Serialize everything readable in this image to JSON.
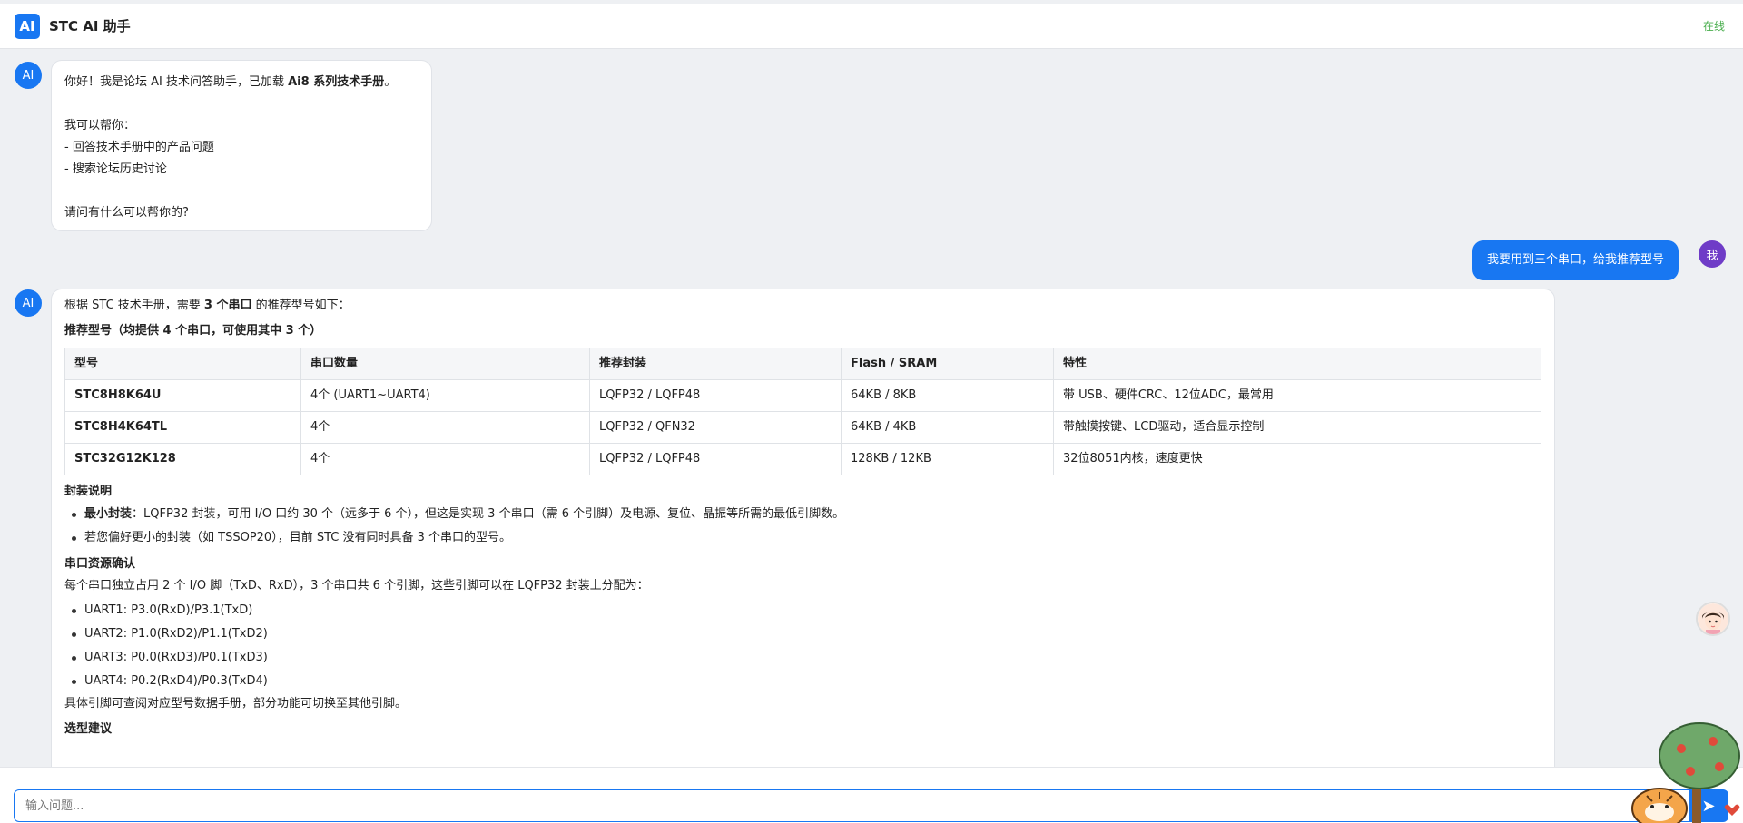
{
  "header": {
    "logo": "AI",
    "title": "STC AI 助手",
    "status": "在线"
  },
  "messages": {
    "ai_avatar": "AI",
    "me_avatar": "我",
    "greeting": {
      "line1_pre": "你好！我是论坛 AI 技术问答助手，已加载 ",
      "line1_bold": "Ai8 系列技术手册",
      "line1_post": "。",
      "line2": "我可以帮你：",
      "line3": "- 回答技术手册中的产品问题",
      "line4": "- 搜索论坛历史讨论",
      "line5": "请问有什么可以帮你的?"
    },
    "user_question": "我要用到三个串口，给我推荐型号",
    "answer": {
      "intro_pre": "根据 STC 技术手册，需要 ",
      "intro_bold": "3 个串口",
      "intro_post": " 的推荐型号如下：",
      "table_title": "推荐型号（均提供 4 个串口，可使用其中 3 个）",
      "columns": [
        "型号",
        "串口数量",
        "推荐封装",
        "Flash / SRAM",
        "特性"
      ],
      "rows": [
        [
          "STC8H8K64U",
          "4个 (UART1~UART4)",
          "LQFP32 / LQFP48",
          "64KB / 8KB",
          "带 USB、硬件CRC、12位ADC，最常用"
        ],
        [
          "STC8H4K64TL",
          "4个",
          "LQFP32 / QFN32",
          "64KB / 4KB",
          "带触摸按键、LCD驱动，适合显示控制"
        ],
        [
          "STC32G12K128",
          "4个",
          "LQFP32 / LQFP48",
          "128KB / 12KB",
          "32位8051内核，速度更快"
        ]
      ],
      "package_title": "封装说明",
      "package_items": {
        "item1_bold": "最小封装",
        "item1_rest": "：LQFP32 封装，可用 I/O 口约 30 个（远多于 6 个），但这是实现 3 个串口（需 6 个引脚）及电源、复位、晶振等所需的最低引脚数。",
        "item2": "若您偏好更小的封装（如 TSSOP20），目前 STC 没有同时具备 3 个串口的型号。"
      },
      "uart_title": "串口资源确认",
      "uart_desc": "每个串口独立占用 2 个 I/O 脚（TxD、RxD），3 个串口共 6 个引脚，这些引脚可以在 LQFP32 封装上分配为：",
      "uart_items": [
        "UART1: P3.0(RxD)/P3.1(TxD)",
        "UART2: P1.0(RxD2)/P1.1(TxD2)",
        "UART3: P0.0(RxD3)/P0.1(TxD3)",
        "UART4: P0.2(RxD4)/P0.3(TxD4)"
      ],
      "uart_note": "具体引脚可查阅对应型号数据手册，部分功能可切换至其他引脚。",
      "selection_title": "选型建议"
    }
  },
  "input": {
    "placeholder": "输入问题..."
  },
  "icons": {
    "send": "send-icon",
    "assistant_avatar": "girl-avatar-icon",
    "mascot": "tiger-tree-mascot"
  },
  "colors": {
    "accent": "#1877f2",
    "online": "#4caf50",
    "user_avatar": "#6f3cc7"
  }
}
